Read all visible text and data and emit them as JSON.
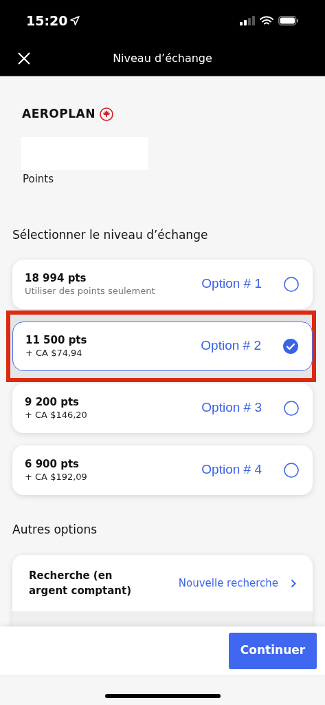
{
  "status_bar": {
    "time": "15:20"
  },
  "header": {
    "title": "Niveau d’échange"
  },
  "brand": {
    "name": "AEROPLAN"
  },
  "points": {
    "label": "Points"
  },
  "section_title": "Sélectionner le niveau d’échange",
  "options": [
    {
      "points": "18 994 pts",
      "detail": "Utiliser des points seulement",
      "label": "Option # 1",
      "selected": false,
      "highlighted": false
    },
    {
      "points": "11 500 pts",
      "detail": "+ CA $74,94",
      "label": "Option # 2",
      "selected": true,
      "highlighted": true
    },
    {
      "points": "9 200 pts",
      "detail": "+ CA $146,20",
      "label": "Option # 3",
      "selected": false,
      "highlighted": false
    },
    {
      "points": "6 900 pts",
      "detail": "+ CA $192,09",
      "label": "Option # 4",
      "selected": false,
      "highlighted": false
    }
  ],
  "other_title": "Autres options",
  "other_card": {
    "title": "Recherche (en argent comptant)",
    "link": "Nouvelle recherche"
  },
  "continue_button": "Continuer"
}
